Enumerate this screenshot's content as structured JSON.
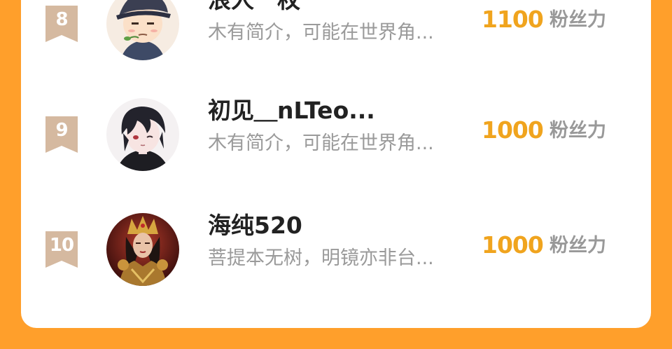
{
  "colors": {
    "background": "#FF9F2B",
    "card": "#FFFFFF",
    "rank_badge": "#D5B9A0",
    "score": "#F0A41E",
    "name": "#222222",
    "bio": "#9A9A9A",
    "unit": "#999999"
  },
  "leaderboard": {
    "entries": [
      {
        "rank": "8",
        "name": "浪人一枚",
        "bio": "木有简介，可能在世界角...",
        "score": "1100",
        "unit": "粉丝力",
        "avatar": "cartoon-boy-avatar"
      },
      {
        "rank": "9",
        "name": "初见＿nLTeo...",
        "bio": "木有简介，可能在世界角...",
        "score": "1000",
        "unit": "粉丝力",
        "avatar": "anime-boy-avatar"
      },
      {
        "rank": "10",
        "name": "海纯520",
        "bio": "菩提本无树，明镜亦非台...",
        "score": "1000",
        "unit": "粉丝力",
        "avatar": "fantasy-queen-avatar"
      }
    ]
  }
}
